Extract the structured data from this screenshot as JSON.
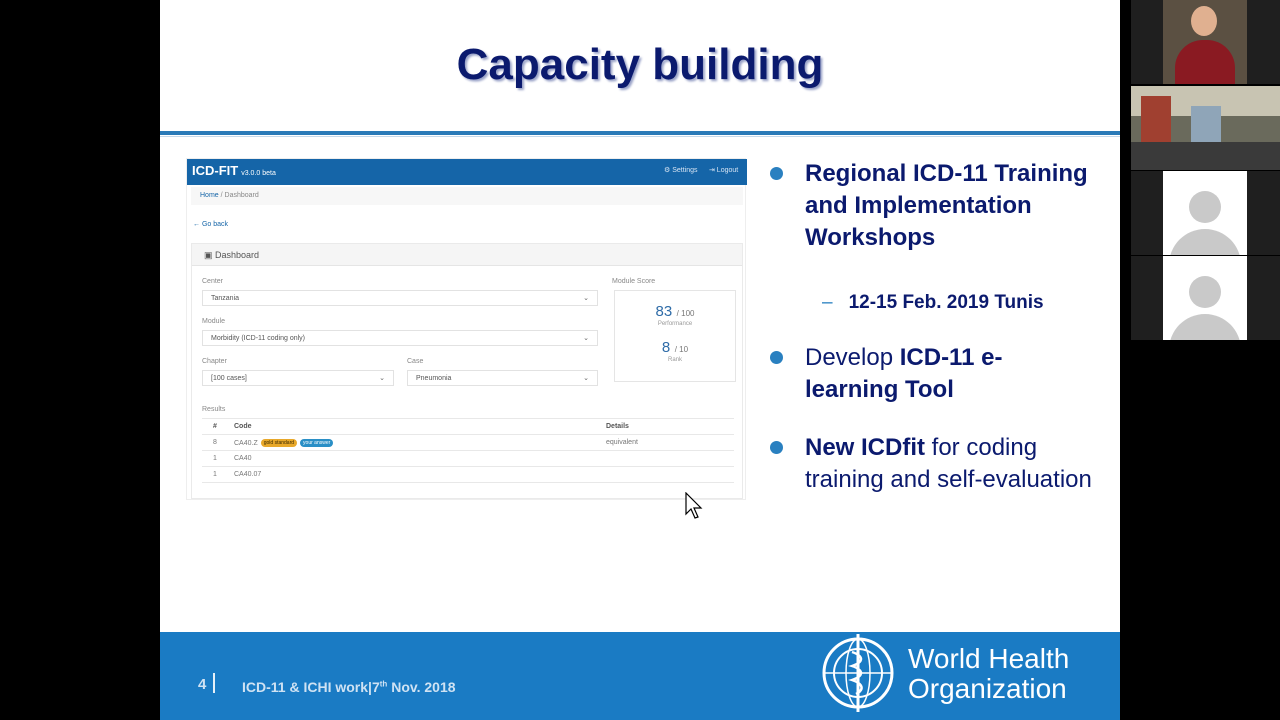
{
  "slide": {
    "title": "Capacity building",
    "bullets": [
      {
        "bold": "Regional ICD-11 Training and Implementation Workshops",
        "rest": ""
      },
      {
        "pre": "Develop ",
        "bold": "ICD-11 e-learning Tool",
        "rest": ""
      },
      {
        "bold": "New ICDfit",
        "rest": " for coding training and self-evaluation"
      }
    ],
    "sub_bullet": "12-15 Feb. 2019 Tunis",
    "footer": {
      "page_number": "4",
      "text_main": "ICD-11 & ICHI work",
      "text_day": "7",
      "text_sup": "th",
      "text_rest": " Nov. 2018",
      "org_line1": "World Health",
      "org_line2": "Organization"
    }
  },
  "app": {
    "brand": "ICD-FIT",
    "version": "v3.0.0 beta",
    "nav": {
      "settings": "⚙ Settings",
      "logout": "⇥ Logout"
    },
    "breadcrumb": {
      "home": "Home",
      "sep": " / ",
      "current": "Dashboard"
    },
    "go_back": "← Go back",
    "panel_title": "Dashboard",
    "center_label": "Center",
    "center_value": "Tanzania",
    "module_label": "Module",
    "module_value": "Morbidity (ICD-11 coding only)",
    "chapter_label": "Chapter",
    "chapter_value": "[100 cases]",
    "case_label": "Case",
    "case_value": "Pneumonia",
    "module_score_label": "Module Score",
    "performance_value": "83",
    "performance_total": "/ 100",
    "performance_label": "Performance",
    "rank_value": "8",
    "rank_total": "/ 10",
    "rank_label": "Rank",
    "results_label": "Results",
    "results_headers": [
      "#",
      "Code",
      "Details"
    ],
    "results_rows": [
      {
        "num": "8",
        "code": "CA40.Z",
        "badges": [
          "gold standard",
          "your answer"
        ],
        "details": "equivalent"
      },
      {
        "num": "1",
        "code": "CA40",
        "badges": [],
        "details": ""
      },
      {
        "num": "1",
        "code": "CA40.07",
        "badges": [],
        "details": ""
      }
    ]
  },
  "colors": {
    "title": "#0b1a6e",
    "accent": "#2a80c0",
    "footer": "#1a7bc4",
    "app_nav": "#1565a8"
  },
  "video_tiles": [
    "participant-video",
    "room-video",
    "avatar-placeholder",
    "avatar-placeholder"
  ]
}
